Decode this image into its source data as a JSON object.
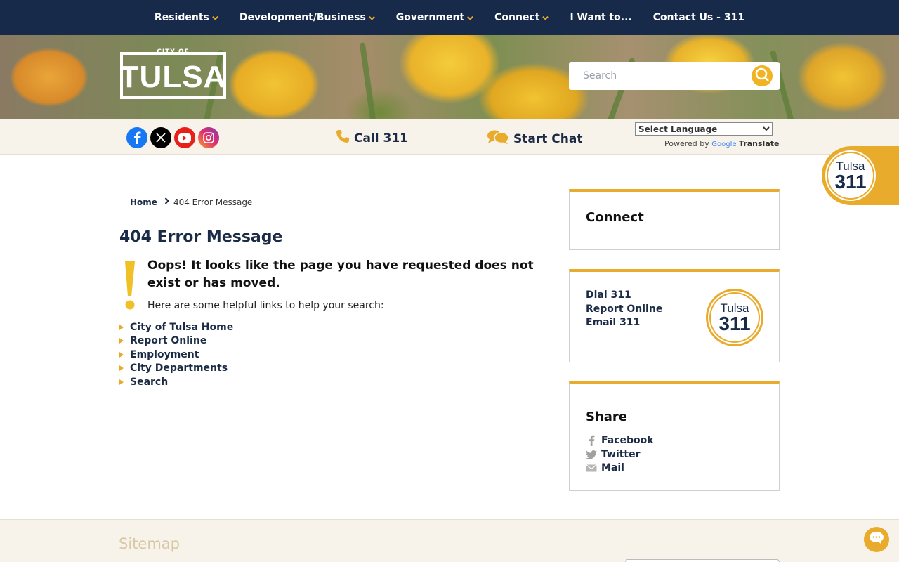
{
  "nav": {
    "items": [
      {
        "label": "Residents",
        "has_dropdown": true
      },
      {
        "label": "Development/Business",
        "has_dropdown": true
      },
      {
        "label": "Government",
        "has_dropdown": true
      },
      {
        "label": "Connect",
        "has_dropdown": true
      },
      {
        "label": "I Want to...",
        "has_dropdown": false
      },
      {
        "label": "Contact Us - 311",
        "has_dropdown": false
      }
    ]
  },
  "header": {
    "logo_small": "CITY OF",
    "logo_main": "TULSA",
    "search_placeholder": "Search"
  },
  "utility": {
    "social_icons": [
      "facebook-icon",
      "x-twitter-icon",
      "youtube-icon",
      "instagram-icon"
    ],
    "call_label": "Call 311",
    "chat_label": "Start Chat",
    "language_select": "Select Language",
    "powered_by": "Powered by",
    "google": "Google",
    "translate": "Translate"
  },
  "tab311": {
    "line1": "Tulsa",
    "line2": "311"
  },
  "breadcrumb": {
    "home": "Home",
    "current": "404 Error Message"
  },
  "main": {
    "title": "404 Error Message",
    "oops": "Oops! It looks like the page you have requested does not exist or has moved.",
    "helpful": "Here are some helpful links to help your search:",
    "links": [
      "City of Tulsa Home",
      "Report Online",
      "Employment",
      "City Departments",
      "Search"
    ]
  },
  "sidebar": {
    "connect_title": "Connect",
    "contact_items": [
      "Dial 311",
      "Report Online",
      "Email 311"
    ],
    "logo311": {
      "line1": "Tulsa",
      "line2": "311"
    },
    "share_title": "Share",
    "share_items": [
      {
        "label": "Facebook",
        "icon": "facebook-icon"
      },
      {
        "label": "Twitter",
        "icon": "twitter-bird-icon"
      },
      {
        "label": "Mail",
        "icon": "mail-icon"
      }
    ]
  },
  "footer": {
    "sitemap_title": "Sitemap"
  },
  "colors": {
    "navy": "#182a4a",
    "gold": "#e9ab2c",
    "cream": "#f7f3ea"
  }
}
